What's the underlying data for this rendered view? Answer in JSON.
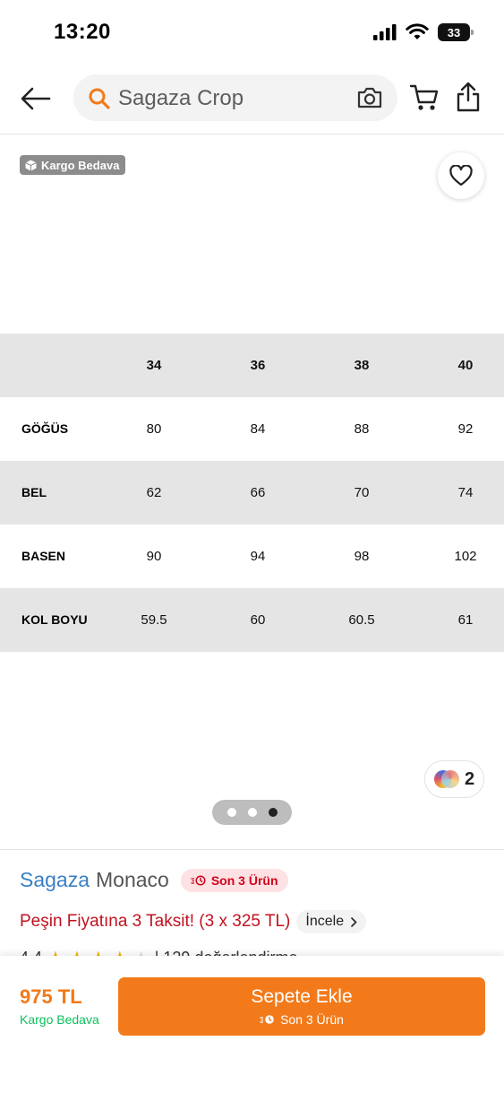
{
  "status_bar": {
    "time": "13:20",
    "battery": "33"
  },
  "header": {
    "search_text": "Sagaza Crop"
  },
  "image": {
    "cargo_badge": "Kargo Bedava",
    "pager": {
      "count": 3,
      "active_index": 2
    },
    "variants_count": "2"
  },
  "size_table": {
    "headers": [
      "",
      "34",
      "36",
      "38",
      "40"
    ],
    "rows": [
      {
        "label": "GÖĞÜS",
        "values": [
          "80",
          "84",
          "88",
          "92"
        ]
      },
      {
        "label": "BEL",
        "values": [
          "62",
          "66",
          "70",
          "74"
        ]
      },
      {
        "label": "BASEN",
        "values": [
          "90",
          "94",
          "98",
          "102"
        ]
      },
      {
        "label": "KOL BOYU",
        "values": [
          "59.5",
          "60",
          "60.5",
          "61"
        ]
      }
    ]
  },
  "product": {
    "brand": "Sagaza",
    "name": "Monaco",
    "stock_badge": "Son 3 Ürün",
    "installment_text": "Peşin Fiyatına 3 Taksit! (3 x 325 TL)",
    "incele_label": "İncele",
    "rating": "4.4",
    "rating_count": "| 129 değerlendirme"
  },
  "bottom_bar": {
    "price": "975 TL",
    "free_shipping": "Kargo Bedava",
    "cta_label": "Sepete Ekle",
    "cta_sub": "Son 3 Ürün"
  },
  "colors": {
    "accent": "#f27a1a",
    "brand_blue": "#3a7fc4",
    "stock_red": "#d0021b",
    "free_ship_green": "#0bc15c"
  }
}
